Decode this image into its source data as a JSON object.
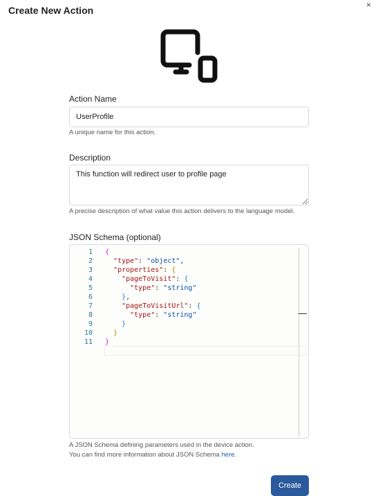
{
  "dialog": {
    "title": "Create New Action",
    "close": "×"
  },
  "action_name": {
    "label": "Action Name",
    "value": "UserProfile",
    "help": "A unique name for this action."
  },
  "description": {
    "label": "Description",
    "value": "This function will redirect user to profile page",
    "help": "A precise description of what value this action delivers to the language model."
  },
  "schema": {
    "label": "JSON Schema (optional)",
    "line_numbers": [
      "1",
      "2",
      "3",
      "4",
      "5",
      "6",
      "7",
      "8",
      "9",
      "10",
      "11"
    ],
    "help1": "A JSON Schema defining parameters used in the device action.",
    "help2": "You can find more information about JSON Schema ",
    "help_link": "here",
    "help_end": "."
  },
  "create_label": "Create"
}
